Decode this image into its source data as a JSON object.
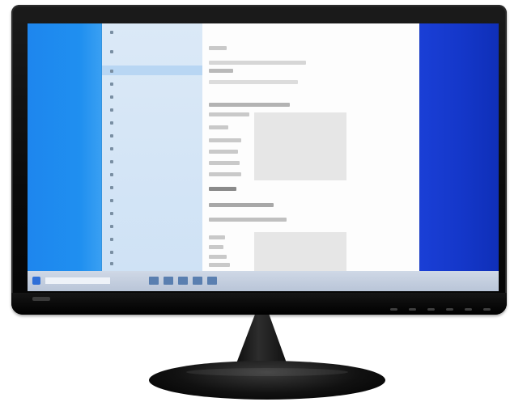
{
  "window": {
    "sidebar": {
      "items": [
        {
          "label": ""
        },
        {
          "label": ""
        },
        {
          "label": ""
        },
        {
          "label": ""
        },
        {
          "label": ""
        },
        {
          "label": ""
        },
        {
          "label": ""
        },
        {
          "label": ""
        },
        {
          "label": ""
        },
        {
          "label": ""
        },
        {
          "label": ""
        },
        {
          "label": ""
        },
        {
          "label": ""
        },
        {
          "label": ""
        },
        {
          "label": ""
        },
        {
          "label": ""
        },
        {
          "label": ""
        },
        {
          "label": ""
        }
      ],
      "selected_index": 2
    },
    "main": {
      "rows": [
        {
          "label": ""
        },
        {
          "label": ""
        },
        {
          "label": ""
        },
        {
          "label": ""
        },
        {
          "label": ""
        },
        {
          "label": ""
        },
        {
          "label": ""
        },
        {
          "label": ""
        },
        {
          "label": ""
        },
        {
          "label": ""
        },
        {
          "label": ""
        },
        {
          "label": ""
        },
        {
          "label": ""
        }
      ]
    }
  },
  "taskbar": {
    "tray": [
      "",
      "",
      "",
      ""
    ]
  },
  "colors": {
    "desktop_left": "#1f8ff0",
    "desktop_right": "#1437c9",
    "sidebar_bg": "#d6e6f6",
    "selection": "#b8d6f3"
  },
  "icons": {
    "start": "windows-start-icon",
    "apps": "taskbar-app-icon"
  }
}
